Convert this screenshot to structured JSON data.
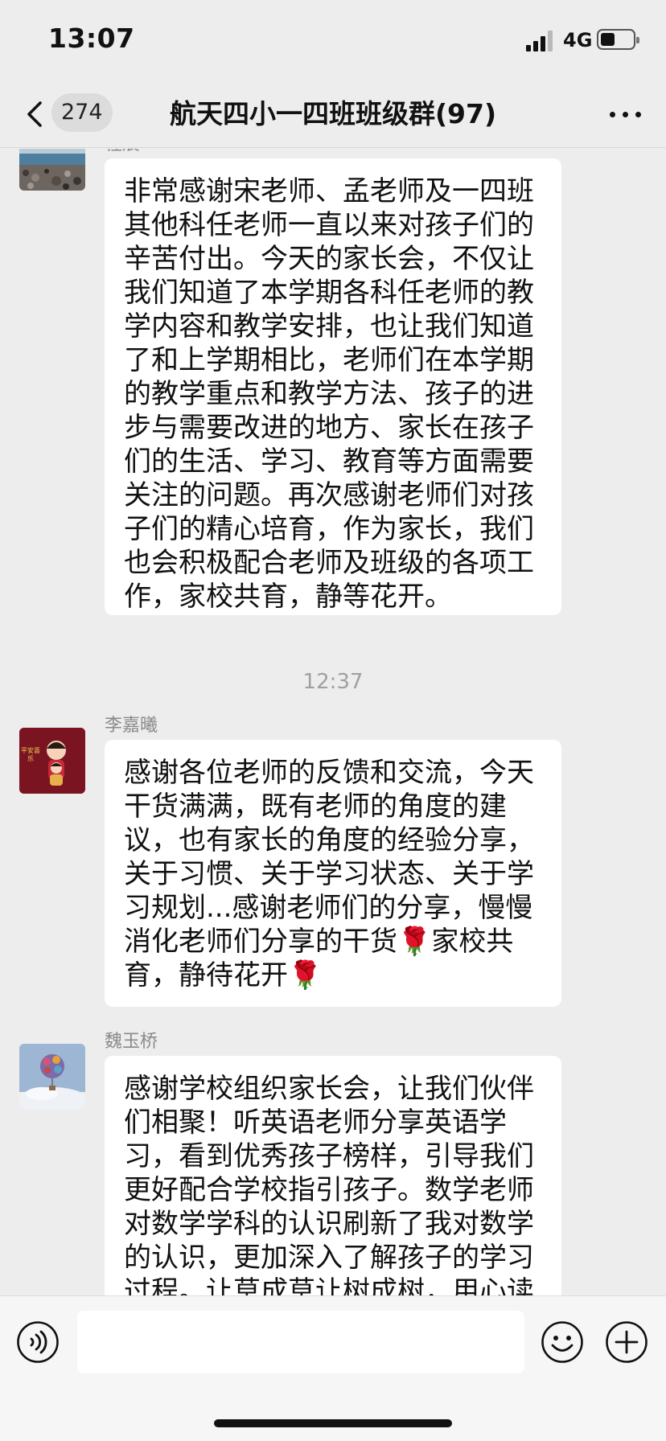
{
  "status_bar": {
    "time": "13:07",
    "network": "4G",
    "battery_level": 0.45
  },
  "nav": {
    "unread_count": "274",
    "title": "航天四小一四班班级群(97)"
  },
  "messages": [
    {
      "sender": "程展",
      "avatar_icon": "seaside-rocks-photo",
      "text": "非常感谢宋老师、孟老师及一四班其他科任老师一直以来对孩子们的辛苦付出。今天的家长会，不仅让我们知道了本学期各科任老师的教学内容和教学安排，也让我们知道了和上学期相比，老师们在本学期的教学重点和教学方法、孩子的进步与需要改进的地方、家长在孩子们的生活、学习、教育等方面需要关注的问题。再次感谢老师们对孩子们的精心培育，作为家长，我们也会积极配合老师及班级的各项工作，家校共育，静等花开。"
    },
    {
      "timestamp": "12:37"
    },
    {
      "sender": "李嘉曦",
      "avatar_icon": "new-year-cartoon-avatar",
      "avatar_text": "平安喜乐",
      "text": "感谢各位老师的反馈和交流，今天干货满满，既有老师的角度的建议，也有家长的角度的经验分享，关于习惯、关于学习状态、关于学习规划...感谢老师们的分享，慢慢消化老师们分享的干货🌹家校共育，静待花开🌹"
    },
    {
      "sender": "魏玉桥",
      "avatar_icon": "hot-air-balloon-avatar",
      "text": "感谢学校组织家长会，让我们伙伴们相聚！听英语老师分享英语学习，看到优秀孩子榜样，引导我们更好配合学校指引孩子。数学老师对数学学科的认识刷新了我对数学的认识，更加深入了解孩子的学习过程。让草成草让树成树，用心读"
    }
  ],
  "input": {
    "value": "",
    "placeholder": ""
  },
  "colors": {
    "background": "#ededed",
    "bubble": "#ffffff",
    "input_bar": "#f6f6f6",
    "name_text": "#8a8a8a"
  }
}
